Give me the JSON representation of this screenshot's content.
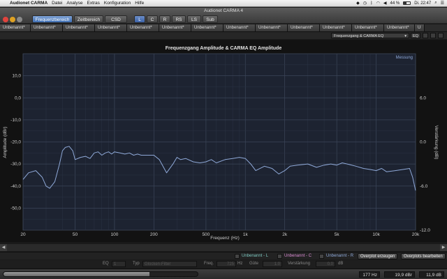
{
  "menubar": {
    "apple": "",
    "app_name": "Audionet CARMA",
    "items": [
      "Datei",
      "Analyse",
      "Extras",
      "Konfiguration",
      "Hilfe"
    ],
    "battery": "44 %",
    "clock": "Di. 22:47"
  },
  "window": {
    "title": "Audionet CARMA 4"
  },
  "toolbar": {
    "views": [
      "Frequenzbereich",
      "Zeitbereich",
      "CSD"
    ],
    "active_view": "Frequenzbereich",
    "channels": [
      "L",
      "C",
      "R",
      "RS",
      "LS",
      "Sub"
    ]
  },
  "tabs": [
    "Unbenannt*",
    "Unbenannt*",
    "Unbenannt*",
    "Unbenannt*",
    "Unbenannt*",
    "Unbenannt*",
    "Unbenannt*",
    "Unbenannt*",
    "Unbenannt*",
    "Unbenannt*",
    "Unbenannt*",
    "Unbenannt*",
    "Unbenannt*",
    "U"
  ],
  "selector": {
    "value": "Frequenzgang & CARMA EQ",
    "eq_button": "EQ"
  },
  "chart_data": {
    "type": "line",
    "title": "Frequenzgang Amplitude & CARMA EQ Amplitude",
    "xlabel": "Frequenz (Hz)",
    "ylabel": "Amplitude (dBr)",
    "y2label": "Verstärkung (dB)",
    "x_scale": "log",
    "xlim": [
      20,
      20000
    ],
    "ylim": [
      -60,
      20
    ],
    "y2lim": [
      -12,
      12
    ],
    "x_ticks": [
      20,
      50,
      100,
      200,
      500,
      1000,
      2000,
      5000,
      10000,
      20000
    ],
    "x_tick_labels": [
      "20",
      "50",
      "100",
      "200",
      "500",
      "1k",
      "2k",
      "5k",
      "10k",
      "20k"
    ],
    "y_ticks": [
      10,
      0,
      -10,
      -20,
      -30,
      -40,
      -50
    ],
    "y_tick_labels": [
      "10,0",
      "0,0",
      "-10,0",
      "-20,0",
      "-30,0",
      "-40,0",
      "-50,0"
    ],
    "y2_ticks": [
      6,
      0,
      -6,
      -12
    ],
    "y2_tick_labels": [
      "6.0",
      "0.0",
      "-6.0",
      "-12.0"
    ],
    "grid": true,
    "legend_position": "top-right",
    "series": [
      {
        "name": "Messung",
        "color": "#8fa9d8",
        "x": [
          20,
          22,
          25,
          28,
          30,
          32,
          35,
          38,
          40,
          42,
          45,
          48,
          50,
          55,
          60,
          65,
          70,
          75,
          80,
          85,
          90,
          95,
          100,
          110,
          120,
          130,
          140,
          150,
          160,
          180,
          200,
          220,
          250,
          280,
          300,
          320,
          350,
          400,
          450,
          500,
          550,
          600,
          700,
          800,
          900,
          1000,
          1100,
          1200,
          1400,
          1600,
          1800,
          2000,
          2200,
          2500,
          3000,
          3500,
          4000,
          4500,
          5000,
          5500,
          6000,
          7000,
          8000,
          9000,
          10000,
          11000,
          12000,
          14000,
          16000,
          18000,
          19000,
          20000
        ],
        "y": [
          -37,
          -34,
          -33,
          -36,
          -40,
          -41,
          -38,
          -30,
          -24,
          -22.5,
          -22,
          -24,
          -28,
          -27,
          -26.5,
          -27.5,
          -25,
          -24.5,
          -26,
          -25,
          -24.5,
          -25.5,
          -24.5,
          -25,
          -25.5,
          -25,
          -26,
          -25.5,
          -26,
          -26,
          -26,
          -28,
          -34,
          -30,
          -27,
          -28,
          -27.5,
          -29,
          -29.5,
          -29,
          -28,
          -29.5,
          -28,
          -27.5,
          -27,
          -27.5,
          -30,
          -33,
          -31,
          -32,
          -34.5,
          -33,
          -31,
          -30.5,
          -30,
          -31.5,
          -30.5,
          -30,
          -30.5,
          -29.5,
          -30,
          -31,
          -32,
          -32.5,
          -33,
          -32,
          -33.5,
          -33,
          -32.5,
          -32,
          -36,
          -42
        ]
      }
    ]
  },
  "scroll": {
    "left_arrow": "◀",
    "right_arrow": "▶"
  },
  "legend_row": {
    "items": [
      {
        "label": "Unbenannt - L",
        "color": "#7ec8c0"
      },
      {
        "label": "Unbenannt - C",
        "color": "#d88ad0"
      },
      {
        "label": "Unbenannt - R",
        "color": "#8fa9d8"
      }
    ],
    "overplot_create": "Overplot erzeugen",
    "overplot_edit": "Overplots bearbeiten"
  },
  "eq_row": {
    "eq_label": "EQ",
    "eq_value": "1",
    "typ_label": "Typ",
    "typ_value": "Glocken-Filter",
    "freq_label": "Freq.",
    "freq_value": "725",
    "freq_unit": "Hz",
    "guete_label": "Güte",
    "guete_value": "1.0",
    "gain_label": "Verstärkung",
    "gain_value": "0.0",
    "gain_unit": "dB"
  },
  "status": {
    "progress": 0.75,
    "freq": "177 Hz",
    "level": "19,9 dBr",
    "gain": "11,9 dB"
  }
}
